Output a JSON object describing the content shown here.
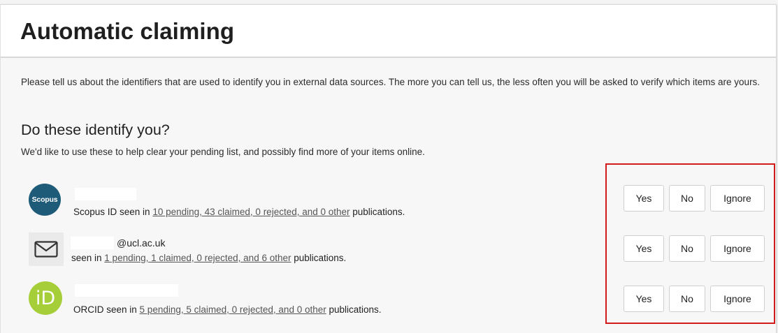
{
  "page": {
    "title": "Automatic claiming"
  },
  "intro": {
    "text": "Please tell us about the identifiers that are used to identify you in external data sources. The more you can tell us, the less often you will be asked to verify which items are yours."
  },
  "section": {
    "heading": "Do these identify you?",
    "description": "We'd like to use these to help clear your pending list, and possibly find more of your items online."
  },
  "identifiers": [
    {
      "icon": "scopus-logo-icon",
      "logo_text": "Scopus",
      "handle": "",
      "prefix": "Scopus ID seen in ",
      "link": "10 pending, 43 claimed, 0 rejected, and 0 other",
      "suffix": " publications."
    },
    {
      "icon": "envelope-icon",
      "handle": "@ucl.ac.uk",
      "prefix": "seen in ",
      "link": "1 pending, 1 claimed, 0 rejected, and 6 other",
      "suffix": " publications."
    },
    {
      "icon": "orcid-logo-icon",
      "logo_text": "iD",
      "handle": "",
      "prefix": "ORCID seen in ",
      "link": "5 pending, 5 claimed, 0 rejected, and 0 other",
      "suffix": " publications."
    }
  ],
  "buttons": {
    "yes": "Yes",
    "no": "No",
    "ignore": "Ignore"
  },
  "colors": {
    "highlight_border": "#d11a1a",
    "scopus": "#1e5b79",
    "orcid": "#a6ce39"
  }
}
